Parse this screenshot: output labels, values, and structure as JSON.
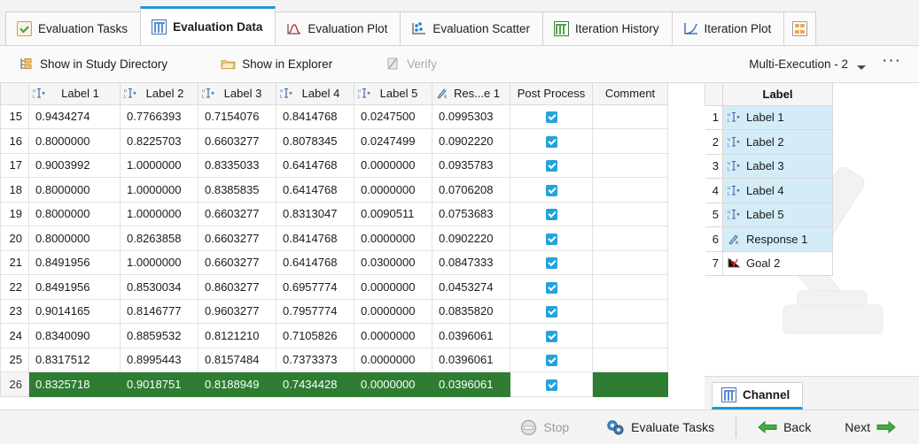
{
  "tabs": [
    {
      "label": "Evaluation Tasks",
      "icon": "checklist-icon",
      "active": false
    },
    {
      "label": "Evaluation Data",
      "icon": "table-grid-icon",
      "active": true
    },
    {
      "label": "Evaluation Plot",
      "icon": "curve-plot-icon",
      "active": false
    },
    {
      "label": "Evaluation Scatter",
      "icon": "scatter-plot-icon",
      "active": false
    },
    {
      "label": "Iteration History",
      "icon": "green-table-icon",
      "active": false
    },
    {
      "label": "Iteration Plot",
      "icon": "line-plot-icon",
      "active": false
    },
    {
      "label": "",
      "icon": "tiles-icon",
      "active": false
    }
  ],
  "toolbar": {
    "show_in_study_directory": "Show in Study Directory",
    "show_in_explorer": "Show in Explorer",
    "verify": "Verify",
    "multi_execution": "Multi-Execution - 2",
    "more_label": "···"
  },
  "table": {
    "columns": [
      "Label 1",
      "Label 2",
      "Label 3",
      "Label 4",
      "Label 5",
      "Res...e 1",
      "Post Process",
      "Comment"
    ],
    "rows": [
      {
        "n": "15",
        "cells": [
          "0.9434274",
          "0.7766393",
          "0.7154076",
          "0.8414768",
          "0.0247500",
          "0.0995303"
        ],
        "checked": true,
        "comment": "",
        "selected": false
      },
      {
        "n": "16",
        "cells": [
          "0.8000000",
          "0.8225703",
          "0.6603277",
          "0.8078345",
          "0.0247499",
          "0.0902220"
        ],
        "checked": true,
        "comment": "",
        "selected": false
      },
      {
        "n": "17",
        "cells": [
          "0.9003992",
          "1.0000000",
          "0.8335033",
          "0.6414768",
          "0.0000000",
          "0.0935783"
        ],
        "checked": true,
        "comment": "",
        "selected": false
      },
      {
        "n": "18",
        "cells": [
          "0.8000000",
          "1.0000000",
          "0.8385835",
          "0.6414768",
          "0.0000000",
          "0.0706208"
        ],
        "checked": true,
        "comment": "",
        "selected": false
      },
      {
        "n": "19",
        "cells": [
          "0.8000000",
          "1.0000000",
          "0.6603277",
          "0.8313047",
          "0.0090511",
          "0.0753683"
        ],
        "checked": true,
        "comment": "",
        "selected": false
      },
      {
        "n": "20",
        "cells": [
          "0.8000000",
          "0.8263858",
          "0.6603277",
          "0.8414768",
          "0.0000000",
          "0.0902220"
        ],
        "checked": true,
        "comment": "",
        "selected": false,
        "focus_col": 1
      },
      {
        "n": "21",
        "cells": [
          "0.8491956",
          "1.0000000",
          "0.6603277",
          "0.6414768",
          "0.0300000",
          "0.0847333"
        ],
        "checked": true,
        "comment": "",
        "selected": false
      },
      {
        "n": "22",
        "cells": [
          "0.8491956",
          "0.8530034",
          "0.8603277",
          "0.6957774",
          "0.0000000",
          "0.0453274"
        ],
        "checked": true,
        "comment": "",
        "selected": false
      },
      {
        "n": "23",
        "cells": [
          "0.9014165",
          "0.8146777",
          "0.9603277",
          "0.7957774",
          "0.0000000",
          "0.0835820"
        ],
        "checked": true,
        "comment": "",
        "selected": false
      },
      {
        "n": "24",
        "cells": [
          "0.8340090",
          "0.8859532",
          "0.8121210",
          "0.7105826",
          "0.0000000",
          "0.0396061"
        ],
        "checked": true,
        "comment": "",
        "selected": false
      },
      {
        "n": "25",
        "cells": [
          "0.8317512",
          "0.8995443",
          "0.8157484",
          "0.7373373",
          "0.0000000",
          "0.0396061"
        ],
        "checked": true,
        "comment": "",
        "selected": false
      },
      {
        "n": "26",
        "cells": [
          "0.8325718",
          "0.9018751",
          "0.8188949",
          "0.7434428",
          "0.0000000",
          "0.0396061"
        ],
        "checked": true,
        "comment": "",
        "selected": true
      }
    ]
  },
  "right_panel": {
    "header": "Label",
    "items": [
      {
        "n": "1",
        "label": "Label 1",
        "icon": "channel-label-icon",
        "selected": true
      },
      {
        "n": "2",
        "label": "Label 2",
        "icon": "channel-label-icon",
        "selected": true
      },
      {
        "n": "3",
        "label": "Label 3",
        "icon": "channel-label-icon",
        "selected": true
      },
      {
        "n": "4",
        "label": "Label 4",
        "icon": "channel-label-icon",
        "selected": true
      },
      {
        "n": "5",
        "label": "Label 5",
        "icon": "channel-label-icon",
        "selected": true
      },
      {
        "n": "6",
        "label": "Response 1",
        "icon": "response-icon",
        "selected": true
      },
      {
        "n": "7",
        "label": "Goal 2",
        "icon": "goal-icon",
        "selected": false
      }
    ],
    "bottom_tab": "Channel"
  },
  "bottom_bar": {
    "stop": "Stop",
    "evaluate_tasks": "Evaluate Tasks",
    "back": "Back",
    "next": "Next"
  },
  "colors": {
    "accent": "#2196d6",
    "selected_row": "#2e7d32",
    "focus_cell": "#e3f4fb",
    "panel_select": "#d4ecf7",
    "checkbox": "#22a3dd",
    "arrow_green": "#3fad3f"
  }
}
